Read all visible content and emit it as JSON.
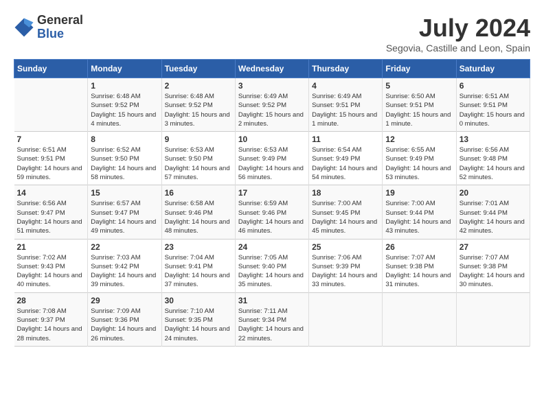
{
  "header": {
    "logo": {
      "general": "General",
      "blue": "Blue"
    },
    "title": "July 2024",
    "location": "Segovia, Castille and Leon, Spain"
  },
  "days_of_week": [
    "Sunday",
    "Monday",
    "Tuesday",
    "Wednesday",
    "Thursday",
    "Friday",
    "Saturday"
  ],
  "weeks": [
    [
      {
        "day": "",
        "sunrise": "",
        "sunset": "",
        "daylight": ""
      },
      {
        "day": "1",
        "sunrise": "Sunrise: 6:48 AM",
        "sunset": "Sunset: 9:52 PM",
        "daylight": "Daylight: 15 hours and 4 minutes."
      },
      {
        "day": "2",
        "sunrise": "Sunrise: 6:48 AM",
        "sunset": "Sunset: 9:52 PM",
        "daylight": "Daylight: 15 hours and 3 minutes."
      },
      {
        "day": "3",
        "sunrise": "Sunrise: 6:49 AM",
        "sunset": "Sunset: 9:52 PM",
        "daylight": "Daylight: 15 hours and 2 minutes."
      },
      {
        "day": "4",
        "sunrise": "Sunrise: 6:49 AM",
        "sunset": "Sunset: 9:51 PM",
        "daylight": "Daylight: 15 hours and 1 minute."
      },
      {
        "day": "5",
        "sunrise": "Sunrise: 6:50 AM",
        "sunset": "Sunset: 9:51 PM",
        "daylight": "Daylight: 15 hours and 1 minute."
      },
      {
        "day": "6",
        "sunrise": "Sunrise: 6:51 AM",
        "sunset": "Sunset: 9:51 PM",
        "daylight": "Daylight: 15 hours and 0 minutes."
      }
    ],
    [
      {
        "day": "7",
        "sunrise": "Sunrise: 6:51 AM",
        "sunset": "Sunset: 9:51 PM",
        "daylight": "Daylight: 14 hours and 59 minutes."
      },
      {
        "day": "8",
        "sunrise": "Sunrise: 6:52 AM",
        "sunset": "Sunset: 9:50 PM",
        "daylight": "Daylight: 14 hours and 58 minutes."
      },
      {
        "day": "9",
        "sunrise": "Sunrise: 6:53 AM",
        "sunset": "Sunset: 9:50 PM",
        "daylight": "Daylight: 14 hours and 57 minutes."
      },
      {
        "day": "10",
        "sunrise": "Sunrise: 6:53 AM",
        "sunset": "Sunset: 9:49 PM",
        "daylight": "Daylight: 14 hours and 56 minutes."
      },
      {
        "day": "11",
        "sunrise": "Sunrise: 6:54 AM",
        "sunset": "Sunset: 9:49 PM",
        "daylight": "Daylight: 14 hours and 54 minutes."
      },
      {
        "day": "12",
        "sunrise": "Sunrise: 6:55 AM",
        "sunset": "Sunset: 9:49 PM",
        "daylight": "Daylight: 14 hours and 53 minutes."
      },
      {
        "day": "13",
        "sunrise": "Sunrise: 6:56 AM",
        "sunset": "Sunset: 9:48 PM",
        "daylight": "Daylight: 14 hours and 52 minutes."
      }
    ],
    [
      {
        "day": "14",
        "sunrise": "Sunrise: 6:56 AM",
        "sunset": "Sunset: 9:47 PM",
        "daylight": "Daylight: 14 hours and 51 minutes."
      },
      {
        "day": "15",
        "sunrise": "Sunrise: 6:57 AM",
        "sunset": "Sunset: 9:47 PM",
        "daylight": "Daylight: 14 hours and 49 minutes."
      },
      {
        "day": "16",
        "sunrise": "Sunrise: 6:58 AM",
        "sunset": "Sunset: 9:46 PM",
        "daylight": "Daylight: 14 hours and 48 minutes."
      },
      {
        "day": "17",
        "sunrise": "Sunrise: 6:59 AM",
        "sunset": "Sunset: 9:46 PM",
        "daylight": "Daylight: 14 hours and 46 minutes."
      },
      {
        "day": "18",
        "sunrise": "Sunrise: 7:00 AM",
        "sunset": "Sunset: 9:45 PM",
        "daylight": "Daylight: 14 hours and 45 minutes."
      },
      {
        "day": "19",
        "sunrise": "Sunrise: 7:00 AM",
        "sunset": "Sunset: 9:44 PM",
        "daylight": "Daylight: 14 hours and 43 minutes."
      },
      {
        "day": "20",
        "sunrise": "Sunrise: 7:01 AM",
        "sunset": "Sunset: 9:44 PM",
        "daylight": "Daylight: 14 hours and 42 minutes."
      }
    ],
    [
      {
        "day": "21",
        "sunrise": "Sunrise: 7:02 AM",
        "sunset": "Sunset: 9:43 PM",
        "daylight": "Daylight: 14 hours and 40 minutes."
      },
      {
        "day": "22",
        "sunrise": "Sunrise: 7:03 AM",
        "sunset": "Sunset: 9:42 PM",
        "daylight": "Daylight: 14 hours and 39 minutes."
      },
      {
        "day": "23",
        "sunrise": "Sunrise: 7:04 AM",
        "sunset": "Sunset: 9:41 PM",
        "daylight": "Daylight: 14 hours and 37 minutes."
      },
      {
        "day": "24",
        "sunrise": "Sunrise: 7:05 AM",
        "sunset": "Sunset: 9:40 PM",
        "daylight": "Daylight: 14 hours and 35 minutes."
      },
      {
        "day": "25",
        "sunrise": "Sunrise: 7:06 AM",
        "sunset": "Sunset: 9:39 PM",
        "daylight": "Daylight: 14 hours and 33 minutes."
      },
      {
        "day": "26",
        "sunrise": "Sunrise: 7:07 AM",
        "sunset": "Sunset: 9:38 PM",
        "daylight": "Daylight: 14 hours and 31 minutes."
      },
      {
        "day": "27",
        "sunrise": "Sunrise: 7:07 AM",
        "sunset": "Sunset: 9:38 PM",
        "daylight": "Daylight: 14 hours and 30 minutes."
      }
    ],
    [
      {
        "day": "28",
        "sunrise": "Sunrise: 7:08 AM",
        "sunset": "Sunset: 9:37 PM",
        "daylight": "Daylight: 14 hours and 28 minutes."
      },
      {
        "day": "29",
        "sunrise": "Sunrise: 7:09 AM",
        "sunset": "Sunset: 9:36 PM",
        "daylight": "Daylight: 14 hours and 26 minutes."
      },
      {
        "day": "30",
        "sunrise": "Sunrise: 7:10 AM",
        "sunset": "Sunset: 9:35 PM",
        "daylight": "Daylight: 14 hours and 24 minutes."
      },
      {
        "day": "31",
        "sunrise": "Sunrise: 7:11 AM",
        "sunset": "Sunset: 9:34 PM",
        "daylight": "Daylight: 14 hours and 22 minutes."
      },
      {
        "day": "",
        "sunrise": "",
        "sunset": "",
        "daylight": ""
      },
      {
        "day": "",
        "sunrise": "",
        "sunset": "",
        "daylight": ""
      },
      {
        "day": "",
        "sunrise": "",
        "sunset": "",
        "daylight": ""
      }
    ]
  ]
}
